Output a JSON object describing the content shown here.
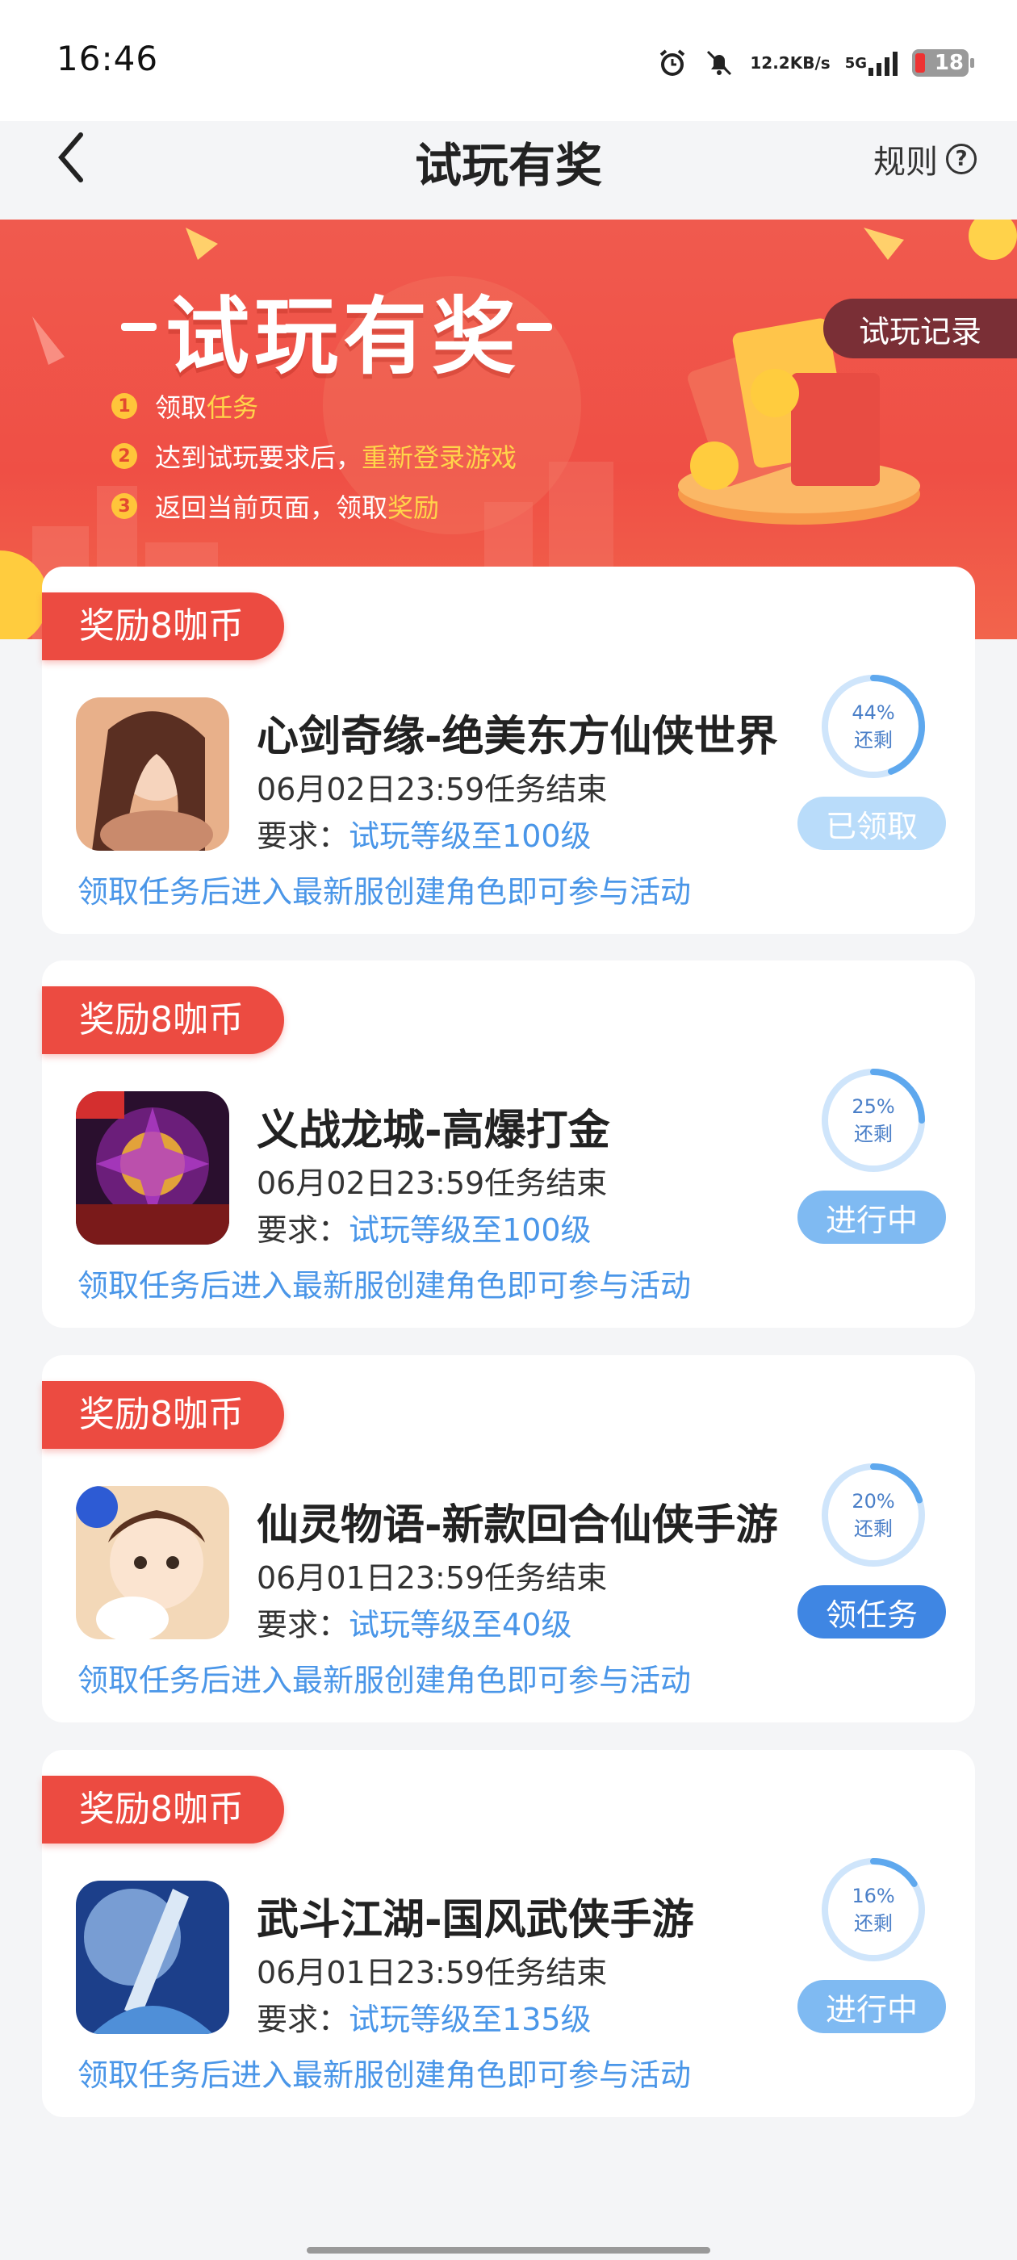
{
  "status_bar": {
    "time": "16:46",
    "net_speed_value": "12.2",
    "net_speed_unit": "KB/s",
    "network": "5G",
    "battery": "18"
  },
  "nav": {
    "title": "试玩有奖",
    "rules_label": "规则"
  },
  "banner": {
    "title": "试玩有奖",
    "record_button": "试玩记录",
    "steps": [
      {
        "num": "1",
        "text": "领取",
        "highlight": "任务",
        "tail": ""
      },
      {
        "num": "2",
        "text": "达到试玩要求后，",
        "highlight": "重新登录游戏",
        "tail": ""
      },
      {
        "num": "3",
        "text": "返回当前页面，领取",
        "highlight": "奖励",
        "tail": ""
      }
    ]
  },
  "tasks": [
    {
      "reward": "奖励8咖币",
      "name": "心剑奇缘-绝美东方仙侠世界",
      "deadline": "06月02日23:59任务结束",
      "req_label": "要求：",
      "req_value": "试玩等级至100级",
      "note": "领取任务后进入最新服创建角色即可参与活动",
      "progress_pct": "44%",
      "progress_label": "还剩",
      "progress_fraction": 0.44,
      "status": "已领取",
      "status_color": "#b9dcfa"
    },
    {
      "reward": "奖励8咖币",
      "name": "义战龙城-高爆打金",
      "deadline": "06月02日23:59任务结束",
      "req_label": "要求：",
      "req_value": "试玩等级至100级",
      "note": "领取任务后进入最新服创建角色即可参与活动",
      "progress_pct": "25%",
      "progress_label": "还剩",
      "progress_fraction": 0.25,
      "status": "进行中",
      "status_color": "#7fbaf2"
    },
    {
      "reward": "奖励8咖币",
      "name": "仙灵物语-新款回合仙侠手游",
      "deadline": "06月01日23:59任务结束",
      "req_label": "要求：",
      "req_value": "试玩等级至40级",
      "note": "领取任务后进入最新服创建角色即可参与活动",
      "progress_pct": "20%",
      "progress_label": "还剩",
      "progress_fraction": 0.2,
      "status": "领任务",
      "status_color": "#3f86e3"
    },
    {
      "reward": "奖励8咖币",
      "name": "武斗江湖-国风武侠手游",
      "deadline": "06月01日23:59任务结束",
      "req_label": "要求：",
      "req_value": "试玩等级至135级",
      "note": "领取任务后进入最新服创建角色即可参与活动",
      "progress_pct": "16%",
      "progress_label": "还剩",
      "progress_fraction": 0.16,
      "status": "进行中",
      "status_color": "#7fbaf2"
    }
  ]
}
